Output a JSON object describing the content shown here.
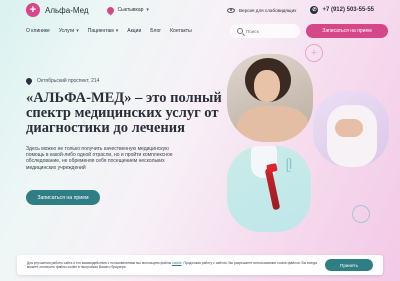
{
  "header": {
    "logo_text": "Альфа-Мед",
    "city": "Сыктывкар",
    "vision_label": "Версия для слабовидящих",
    "phone": "+7 (912) 503-55-55"
  },
  "nav": {
    "items": [
      {
        "label": "О клинике",
        "has_dropdown": false
      },
      {
        "label": "Услуги",
        "has_dropdown": true
      },
      {
        "label": "Пациентам",
        "has_dropdown": true
      },
      {
        "label": "Акции",
        "has_dropdown": false
      },
      {
        "label": "Блог",
        "has_dropdown": false
      },
      {
        "label": "Контакты",
        "has_dropdown": false
      }
    ],
    "search_placeholder": "Поиск",
    "cta_label": "Записаться на прием"
  },
  "hero": {
    "address": "Октябрьский проспект, 214",
    "title": "«АЛЬФА-МЕД» – это полный спектр медицинских услуг от диагностики до лечения",
    "text": "Здесь можно не только получить качественную медицинскую помощь в какой-либо одной отрасли, но и пройти комплексное обследование, не обременяя себя посещением нескольких медицинских учреждений",
    "cta_label": "Записаться на прием"
  },
  "cookie": {
    "text_before": "Для улучшения работы сайта и его взаимодействия с пользователями мы используем файлы",
    "link": "cookie",
    "text_after": ". Продолжая работу с сайтом, Вы разрешаете использование cookie-файлов. Вы всегда можете отключить файлы cookie в настройках Вашего браузера.",
    "accept_label": "Принять"
  },
  "colors": {
    "accent_pink": "#d6478a",
    "accent_teal": "#2f7e86",
    "text_dark": "#2b2f3a"
  }
}
